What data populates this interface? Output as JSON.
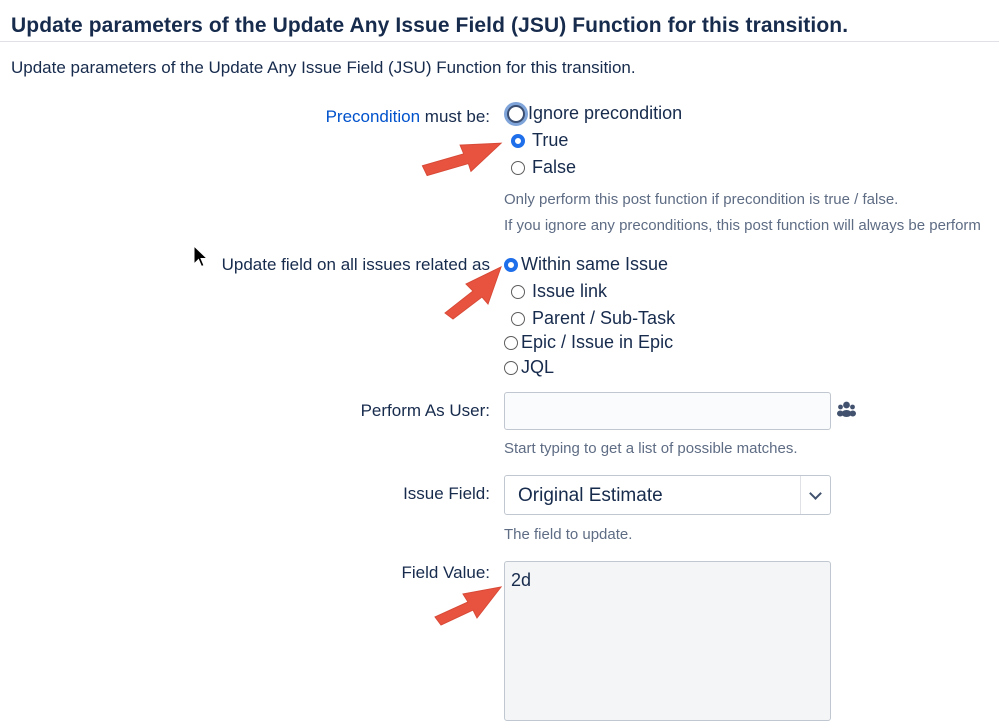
{
  "page": {
    "heading": "Update parameters of the Update Any Issue Field (JSU) Function for this transition.",
    "description": "Update parameters of the Update Any Issue Field (JSU) Function for this transition."
  },
  "precondition": {
    "label_link": "Precondition",
    "label_rest": " must be:",
    "options": [
      "Ignore precondition",
      "True",
      "False"
    ],
    "selected": "True",
    "hint1": "Only perform this post function if precondition is true / false.",
    "hint2": "If you ignore any preconditions, this post function will always be perform"
  },
  "related": {
    "label": "Update field on all issues related as",
    "options": [
      "Within same Issue",
      "Issue link",
      "Parent / Sub-Task",
      "Epic / Issue in Epic",
      "JQL"
    ],
    "selected": "Within same Issue"
  },
  "perform_as_user": {
    "label": "Perform As User:",
    "value": "",
    "hint": "Start typing to get a list of possible matches.",
    "icon": "users-icon"
  },
  "issue_field": {
    "label": "Issue Field:",
    "value": "Original Estimate",
    "hint": "The field to update.",
    "icon": "chevron-down-icon"
  },
  "field_value": {
    "label": "Field Value:",
    "value": "2d"
  },
  "colors": {
    "accent": "#0052cc",
    "radio_checked": "#1f6feb",
    "annotation_arrow": "#e8533f"
  }
}
